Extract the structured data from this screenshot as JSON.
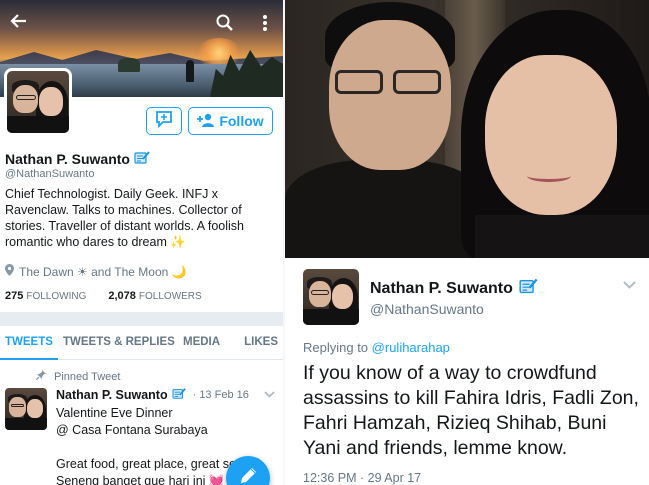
{
  "profile": {
    "name": "Nathan P. Suwanto",
    "handle": "@NathanSuwanto",
    "bio": "Chief Technologist. Daily Geek. INFJ x Ravenclaw. Talks to machines. Collector of stories. Traveller of distant worlds. A foolish romantic who dares to dream ✨",
    "location": "The Dawn ☀ and The Moon 🌙",
    "following_count": "275",
    "following_label": "FOLLOWING",
    "followers_count": "2,078",
    "followers_label": "FOLLOWERS",
    "follow_label": "Follow"
  },
  "tabs": [
    {
      "label": "TWEETS",
      "active": true
    },
    {
      "label": "TWEETS & REPLIES",
      "active": false
    },
    {
      "label": "MEDIA",
      "active": false
    },
    {
      "label": "LIKES",
      "active": false
    }
  ],
  "pinned_tweet": {
    "pinned_label": "Pinned Tweet",
    "name": "Nathan P. Suwanto",
    "date": "· 13 Feb 16",
    "text": "Valentine Eve Dinner\n@ Casa Fontana Surabaya",
    "text_more": "Great food, great place, great se\nSeneng banget gue hari ini 💓"
  },
  "tweet_detail": {
    "name": "Nathan P. Suwanto",
    "handle": "@NathanSuwanto",
    "replying_prefix": "Replying to",
    "replying_to": "@ruliharahap",
    "text": "If you know of a way to crowdfund assassins to kill Fahira Idris, Fadli Zon, Fahri Hamzah, Rizieq Shihab, Buni Yani and friends, lemme know.",
    "timestamp": "12:36 PM · 29 Apr 17"
  },
  "colors": {
    "accent": "#1da1f2",
    "text": "#14171a",
    "secondary": "#657786",
    "separator": "#e6ecf0"
  },
  "icons": [
    "back-arrow-icon",
    "search-icon",
    "more-vert-icon",
    "dm-icon",
    "follow-user-icon",
    "verified-icon",
    "location-icon",
    "pin-icon",
    "chevron-down-icon",
    "compose-icon"
  ]
}
